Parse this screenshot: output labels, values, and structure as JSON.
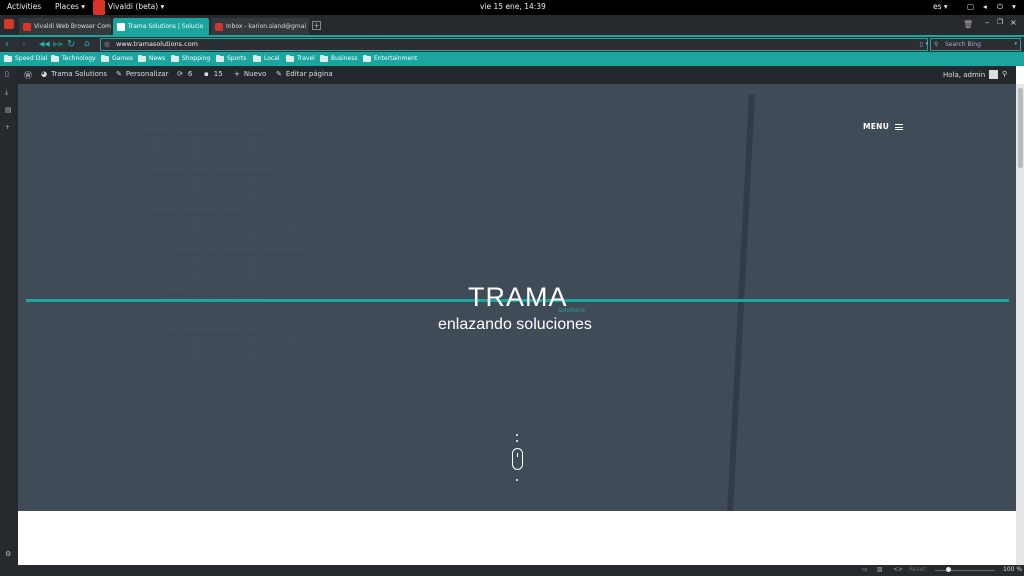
{
  "system_bar": {
    "activities": "Activities",
    "places": "Places",
    "app_name": "Vivaldi (beta)",
    "clock": "vie 15 ene, 14:39",
    "lang": "es"
  },
  "tabs": [
    {
      "label": "Vivaldi Web Browser Com",
      "active": false,
      "favicon_color": "#d9342b"
    },
    {
      "label": "Trama Solutions | Solucio",
      "active": true,
      "favicon_color": "#1aa59f"
    },
    {
      "label": "Inbox - karion.siand@gmai",
      "active": false,
      "favicon_color": "#c33"
    }
  ],
  "nav": {
    "url": "www.tramasolutions.com",
    "search_placeholder": "Search Bing"
  },
  "bookmarks": [
    "Speed Dial",
    "Technology",
    "Games",
    "News",
    "Shopping",
    "Sports",
    "Local",
    "Travel",
    "Business",
    "Entertainment"
  ],
  "wp_admin_bar": {
    "site": "Trama Solutions",
    "customize": "Personalizar",
    "updates": "6",
    "comments": "15",
    "new": "Nuevo",
    "edit": "Editar página",
    "greeting": "Hola, admin"
  },
  "hero": {
    "menu": "MENU",
    "logo": "TRAMA",
    "logo_sub": "solutions",
    "tagline": "enlazando soluciones"
  },
  "status_bar": {
    "reset": "Reset",
    "zoom": "100 %"
  },
  "colors": {
    "accent": "#1aa59f",
    "hero_bg": "#404b58",
    "chrome_dark": "#262a2e"
  }
}
